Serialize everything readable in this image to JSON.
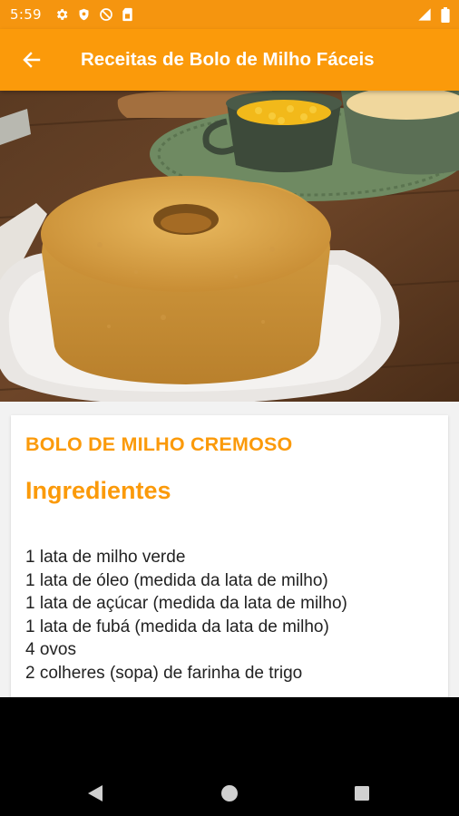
{
  "status_bar": {
    "time": "5:59",
    "left_icons": [
      "gear-icon",
      "shield-icon",
      "no-sync-icon",
      "sim-card-icon"
    ],
    "right_icons": [
      "cell-signal-icon",
      "battery-icon"
    ]
  },
  "app_bar": {
    "title": "Receitas de Bolo de Milho Fáceis",
    "back_icon": "arrow-back-icon",
    "color": "#fb9a0a"
  },
  "recipe": {
    "title": "BOLO DE MILHO CREMOSO",
    "section": "Ingredientes",
    "ingredients": [
      "1 lata de milho verde",
      "1 lata de óleo (medida da lata de milho)",
      "1 lata de açúcar (medida da lata de milho)",
      "1 lata de fubá (medida da lata de milho)",
      "4 ovos",
      "2 colheres (sopa) de farinha de trigo"
    ]
  },
  "nav_bar": {
    "buttons": [
      "back-triangle-icon",
      "home-circle-icon",
      "recents-square-icon"
    ]
  }
}
